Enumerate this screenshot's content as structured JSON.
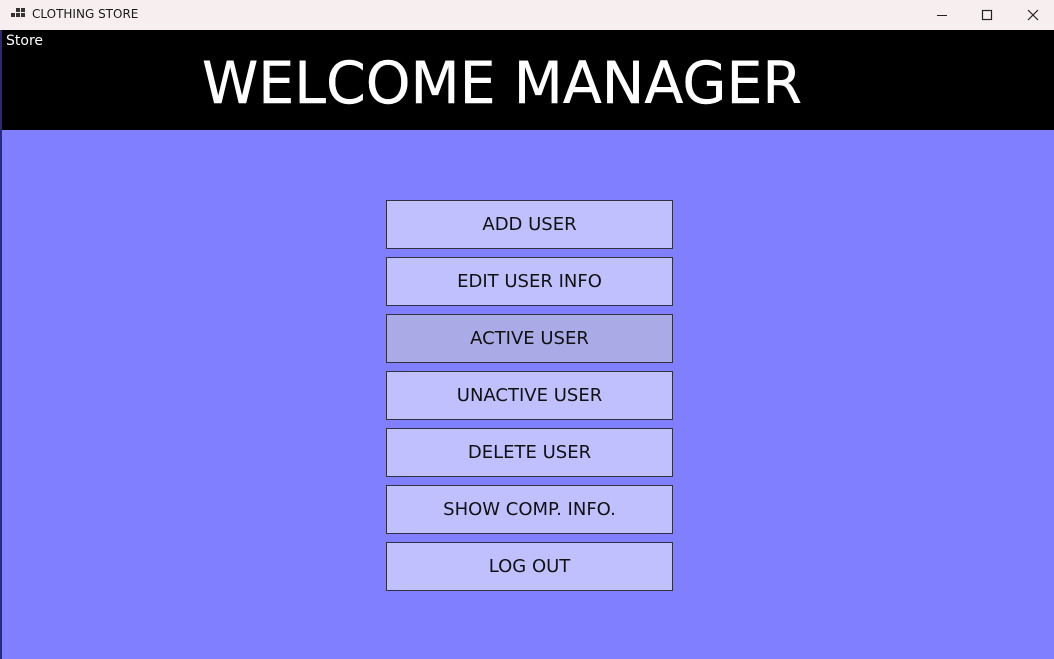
{
  "window": {
    "title": "CLOTHING STORE",
    "controls": {
      "minimize": "minimize-icon",
      "maximize": "maximize-icon",
      "close": "close-icon"
    },
    "background": "#7f7fff"
  },
  "menubar": {
    "store_label": "Store"
  },
  "header": {
    "welcome_text": "WELCOME MANAGER",
    "background": "#000000",
    "text_color": "#ffffff"
  },
  "menu": {
    "button_color": "#c0c0ff",
    "highlight_color": "#aaaae6",
    "buttons": [
      {
        "label": "ADD USER"
      },
      {
        "label": "EDIT USER INFO"
      },
      {
        "label": "ACTIVE USER",
        "highlighted": true
      },
      {
        "label": "UNACTIVE USER"
      },
      {
        "label": "DELETE USER"
      },
      {
        "label": "SHOW COMP. INFO."
      },
      {
        "label": "LOG OUT"
      }
    ]
  }
}
